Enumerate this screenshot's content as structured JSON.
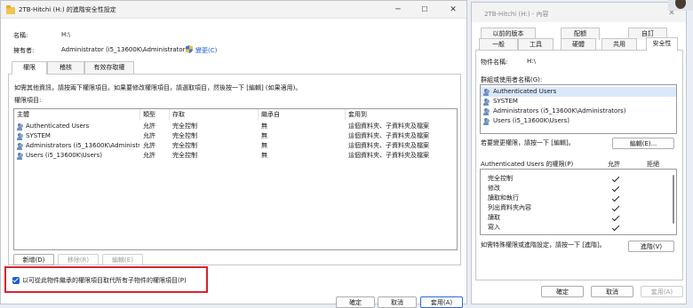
{
  "left_window": {
    "title": "2TB-Hitchi (H:) 的進階安全性設定",
    "name_label": "名稱:",
    "name_value": "H:\\",
    "owner_label": "擁有者:",
    "owner_value": "Administrator (i5_13600K\\Administrator)",
    "change_link": "變更(C)",
    "tabs": [
      "權限",
      "稽核",
      "有效存取權"
    ],
    "instructions": "如需其他資訊，請按兩下權限項目。如果要修改權限項目，請選取項目，然後按一下 [編輯] (如果適用)。",
    "entries_label": "權限項目:",
    "columns": [
      "主體",
      "類型",
      "存取",
      "繼承自",
      "套用到"
    ],
    "rows": [
      {
        "principal": "Authenticated Users",
        "type": "允許",
        "access": "完全控制",
        "inherited": "無",
        "applies": "這個資料夾、子資料夾及檔案"
      },
      {
        "principal": "SYSTEM",
        "type": "允許",
        "access": "完全控制",
        "inherited": "無",
        "applies": "這個資料夾、子資料夾及檔案"
      },
      {
        "principal": "Administrators (i5_13600K\\Administrat...",
        "type": "允許",
        "access": "完全控制",
        "inherited": "無",
        "applies": "這個資料夾、子資料夾及檔案"
      },
      {
        "principal": "Users (i5_13600K\\Users)",
        "type": "允許",
        "access": "完全控制",
        "inherited": "無",
        "applies": "這個資料夾、子資料夾及檔案"
      }
    ],
    "add_button": "新增(D)",
    "remove_button": "移除(R)",
    "edit_button": "編輯(E)",
    "replace_checkbox": "以可從此物件繼承的權限項目取代所有子物件的權限項目(P)",
    "ok_button": "確定",
    "cancel_button": "取消",
    "apply_button": "套用(A)"
  },
  "right_window": {
    "title": "2TB-Hitchi (H:) - 內容",
    "tabs_row1": [
      "以前的版本",
      "配額",
      "自訂"
    ],
    "tabs_row2": [
      "一般",
      "工具",
      "硬體",
      "共用",
      "安全性"
    ],
    "object_name_label": "物件名稱:",
    "object_name_value": "H:\\",
    "groups_label": "群組或使用者名稱(G):",
    "groups": [
      "Authenticated Users",
      "SYSTEM",
      "Administrators (i5_13600K\\Administrators)",
      "Users (i5_13600K\\Users)"
    ],
    "change_hint": "若要變更權限，請按一下 [編輯]。",
    "edit_button": "編輯(E)...",
    "perm_header": "Authenticated Users 的權限(P)",
    "allow_label": "允許",
    "deny_label": "拒絕",
    "permissions": [
      {
        "name": "完全控制",
        "allow": true
      },
      {
        "name": "修改",
        "allow": true
      },
      {
        "name": "讀取和執行",
        "allow": true
      },
      {
        "name": "列出資料夾內容",
        "allow": true
      },
      {
        "name": "讀取",
        "allow": true
      },
      {
        "name": "寫入",
        "allow": true
      }
    ],
    "advanced_hint": "如需特殊權限或進階設定，請按一下 [進階]。",
    "advanced_button": "進階(V)",
    "ok_button": "確定",
    "cancel_button": "取消",
    "apply_button": "套用(A)"
  },
  "colors": {
    "accent": "#1f5fd0",
    "highlight_box": "#d9232f",
    "link": "#1a5bd8"
  }
}
